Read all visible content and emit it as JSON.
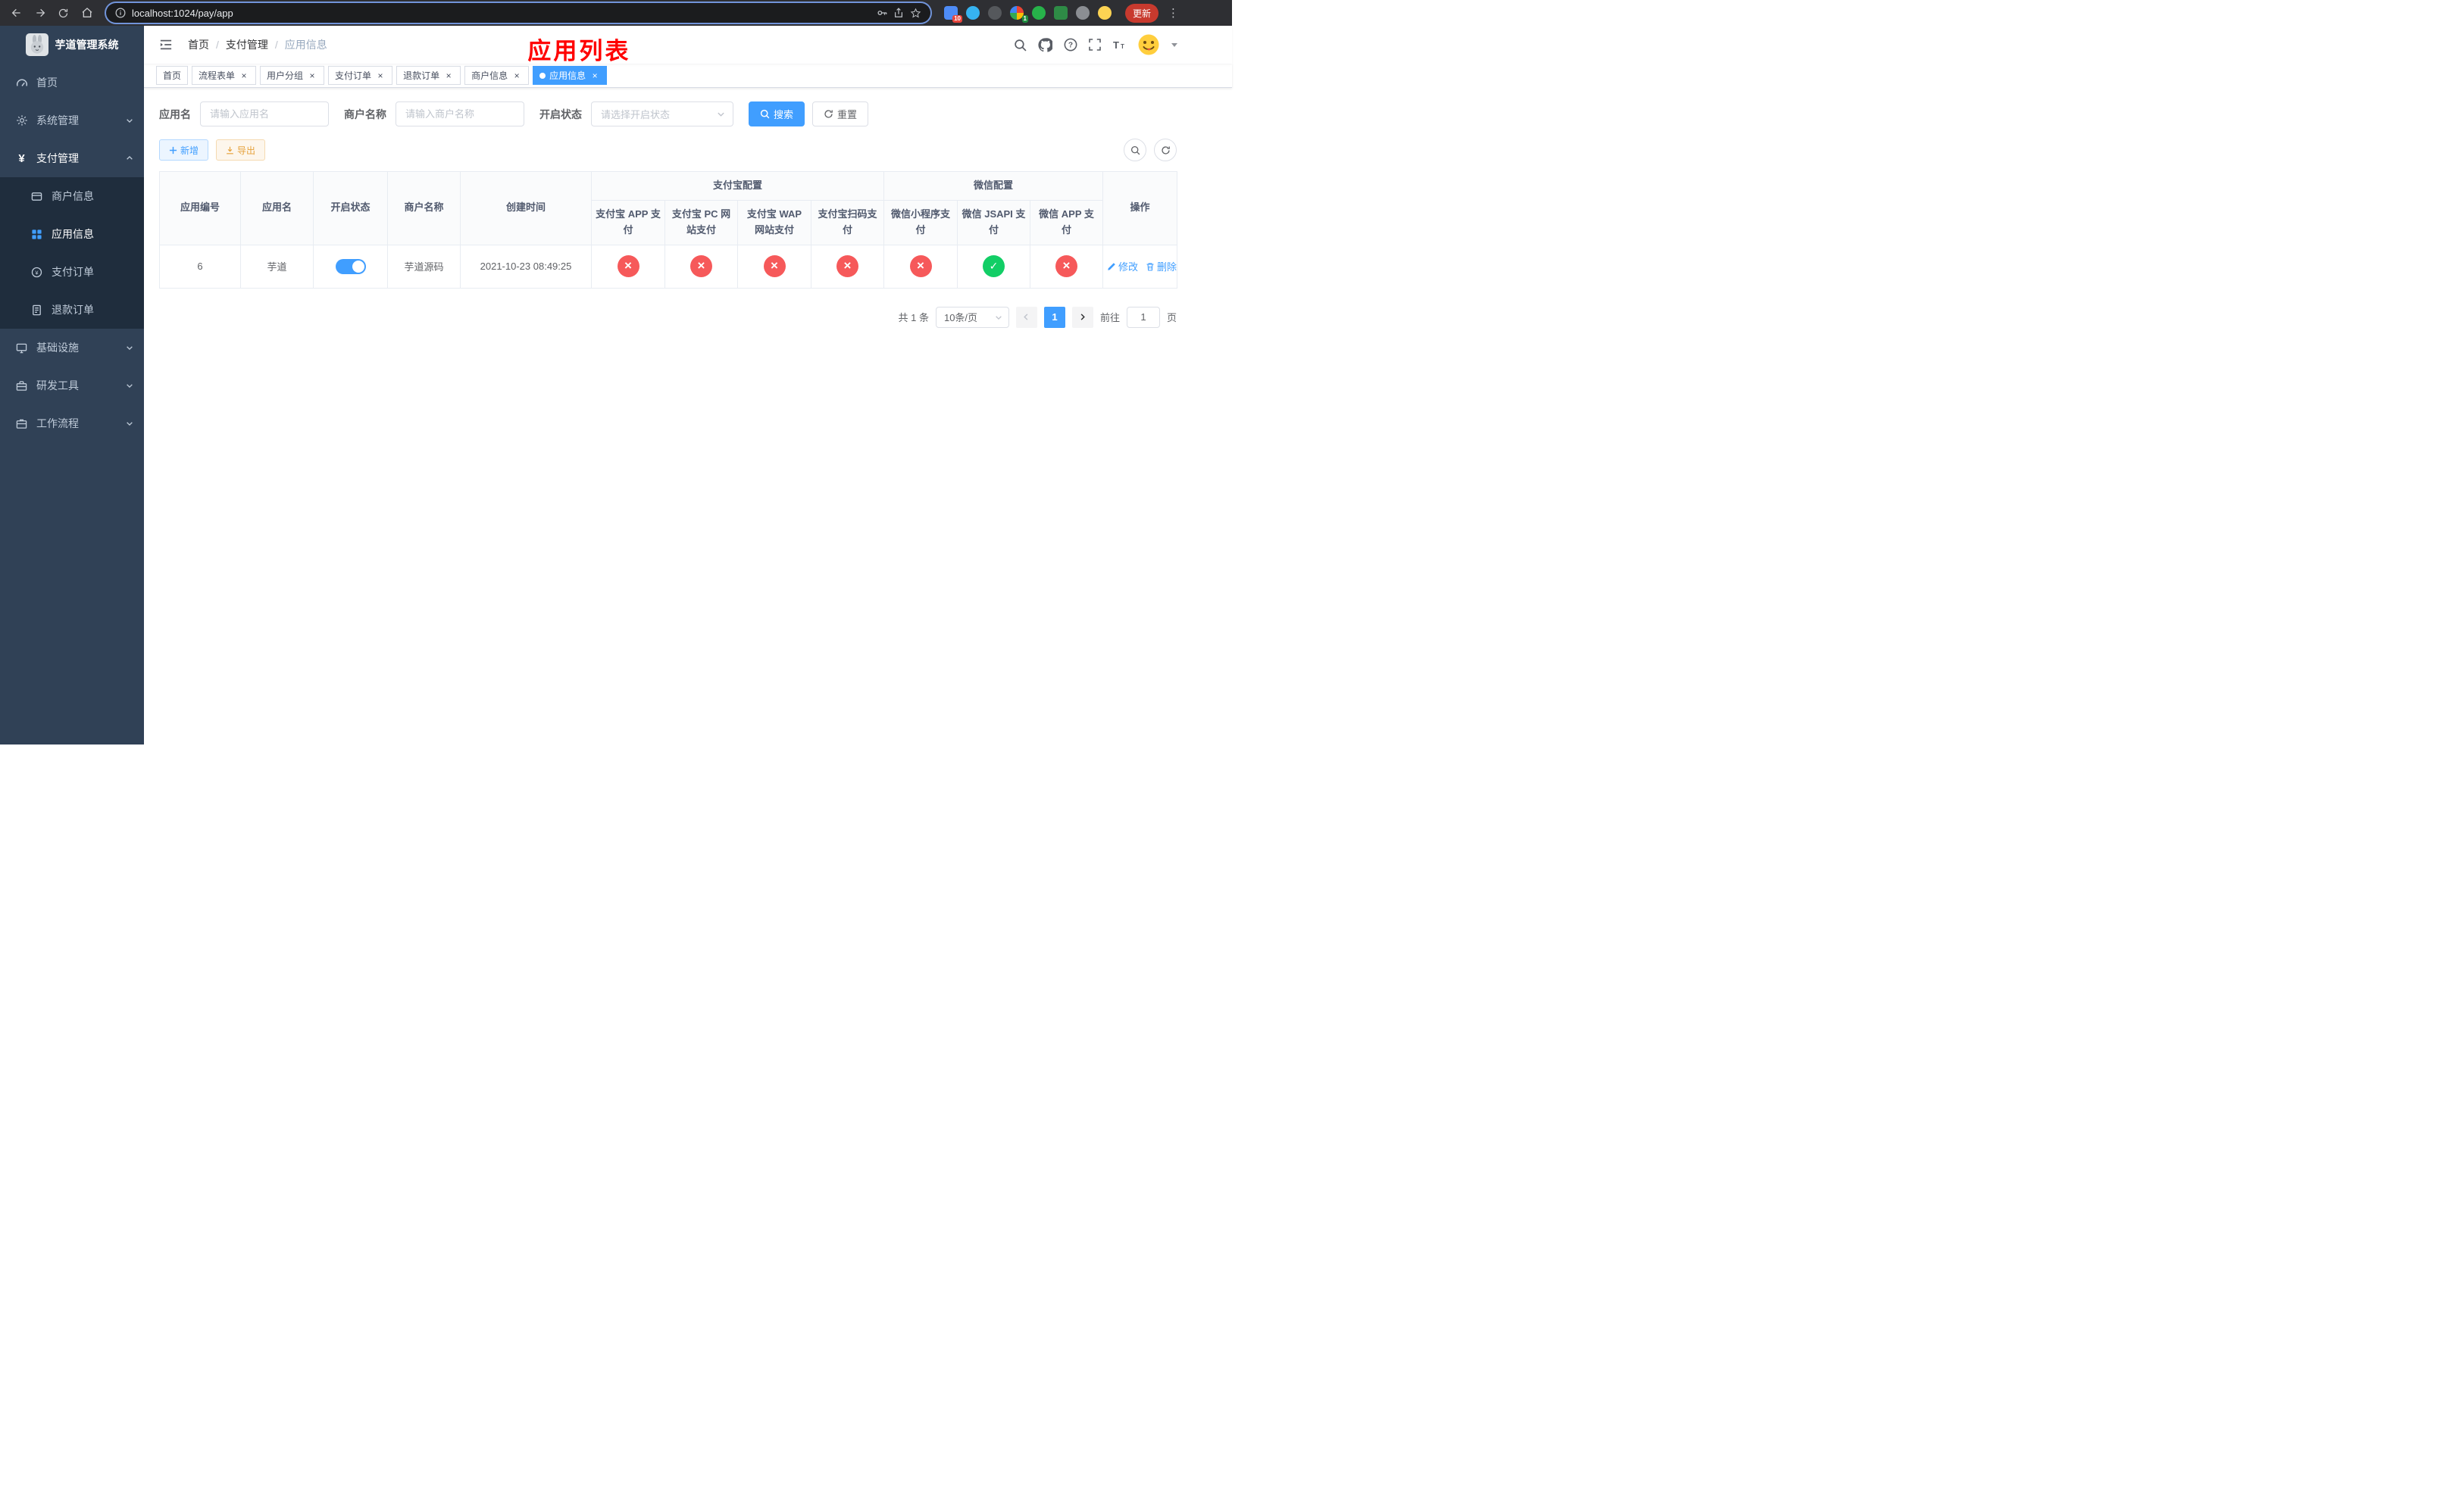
{
  "browser": {
    "url": "localhost:1024/pay/app",
    "update_label": "更新",
    "extension_badges": {
      "first": "10",
      "second": "1"
    }
  },
  "sidebar": {
    "title": "芋道管理系统",
    "home": "首页",
    "system": "系统管理",
    "pay": "支付管理",
    "merchant": "商户信息",
    "app_info": "应用信息",
    "pay_order": "支付订单",
    "refund_order": "退款订单",
    "infra": "基础设施",
    "dev_tools": "研发工具",
    "workflow": "工作流程"
  },
  "navbar": {
    "breadcrumb_home": "首页",
    "breadcrumb_section": "支付管理",
    "breadcrumb_current": "应用信息",
    "annotation": "应用列表"
  },
  "tabs": [
    {
      "label": "首页",
      "closable": false,
      "active": false
    },
    {
      "label": "流程表单",
      "closable": true,
      "active": false
    },
    {
      "label": "用户分组",
      "closable": true,
      "active": false
    },
    {
      "label": "支付订单",
      "closable": true,
      "active": false
    },
    {
      "label": "退款订单",
      "closable": true,
      "active": false
    },
    {
      "label": "商户信息",
      "closable": true,
      "active": false
    },
    {
      "label": "应用信息",
      "closable": true,
      "active": true
    }
  ],
  "filters": {
    "app_name_label": "应用名",
    "app_name_placeholder": "请输入应用名",
    "merchant_label": "商户名称",
    "merchant_placeholder": "请输入商户名称",
    "status_label": "开启状态",
    "status_placeholder": "请选择开启状态",
    "search": "搜索",
    "reset": "重置"
  },
  "toolbar": {
    "add": "新增",
    "export": "导出"
  },
  "table": {
    "col_id": "应用编号",
    "col_name": "应用名",
    "col_status": "开启状态",
    "col_merchant": "商户名称",
    "col_created": "创建时间",
    "group_alipay": "支付宝配置",
    "group_wechat": "微信配置",
    "col_alipay_app": "支付宝 APP 支付",
    "col_alipay_pc": "支付宝 PC 网站支付",
    "col_alipay_wap": "支付宝 WAP 网站支付",
    "col_alipay_scan": "支付宝扫码支付",
    "col_wx_mini": "微信小程序支付",
    "col_wx_jsapi": "微信 JSAPI 支付",
    "col_wx_app": "微信 APP 支付",
    "col_actions": "操作",
    "row": {
      "id": "6",
      "name": "芋道",
      "status_on": true,
      "merchant": "芋道源码",
      "created": "2021-10-23 08:49:25",
      "alipay_app": "disabled",
      "alipay_pc": "disabled",
      "alipay_wap": "disabled",
      "alipay_scan": "disabled",
      "wx_mini": "disabled",
      "wx_jsapi": "enabled",
      "wx_app": "disabled",
      "action_edit": "修改",
      "action_delete": "删除"
    }
  },
  "pagination": {
    "total": "共 1 条",
    "page_size": "10条/页",
    "page": "1",
    "goto_label": "前往",
    "goto_value": "1",
    "page_unit": "页"
  },
  "colors": {
    "accent": "#409eff",
    "danger": "#f6595a",
    "success": "#12ce66",
    "warning": "#e6a23c",
    "annotation": "#ff0000",
    "sidebar_bg": "#304156",
    "submenu_bg": "#1f2d3d"
  }
}
